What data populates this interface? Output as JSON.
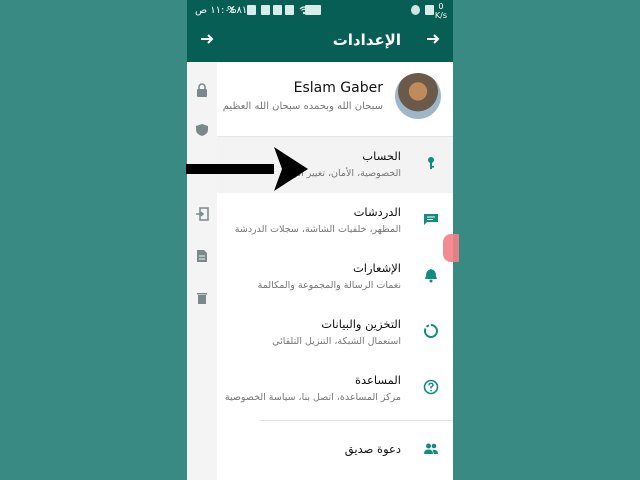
{
  "statusbar": {
    "time": "١١:٠٤ ص",
    "battery": "%٨١",
    "net_speed": "0",
    "net_unit": "K/s"
  },
  "appbar": {
    "title": "الإعدادات"
  },
  "profile": {
    "name": "Eslam Gaber",
    "status": "سبحان الله وبحمده سبحان الله العظيم"
  },
  "menu": [
    {
      "title": "الحساب",
      "subtitle": "الخصوصية، الأمان، تغيير الرقم"
    },
    {
      "title": "الدردشات",
      "subtitle": "المظهر، خلفيات الشاشة، سجلات الدردشة"
    },
    {
      "title": "الإشعارات",
      "subtitle": "نغمات الرسالة والمجموعة والمكالمة"
    },
    {
      "title": "التخزين والبيانات",
      "subtitle": "استعمال الشبكة، التنزيل التلقائي"
    },
    {
      "title": "المساعدة",
      "subtitle": "مركز المساعدة، اتصل بنا، سياسة الخصوصية"
    },
    {
      "title": "دعوة صديق"
    }
  ],
  "colors": {
    "header": "#075e54",
    "accent": "#128c7e",
    "background": "#3a8a84"
  }
}
